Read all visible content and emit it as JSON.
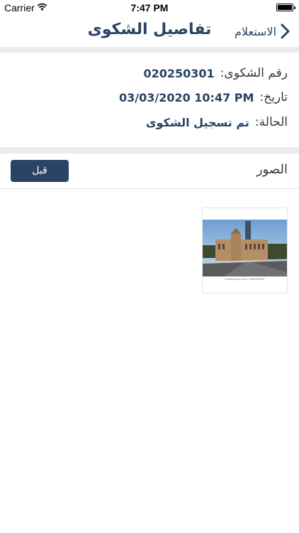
{
  "status_bar": {
    "carrier": "Carrier",
    "time": "7:47 PM"
  },
  "nav": {
    "title": "تفاصيل الشكوى",
    "back_label": "الاستعلام",
    "back_icon": "chevron-right-icon"
  },
  "details": {
    "number_label": "رقم الشكوى:",
    "number_value": "020250301",
    "date_label": "تاريخ:",
    "date_value": "03/03/2020 10:47 PM",
    "status_label": "الحالة:",
    "status_value": "تم تسجيل الشكوى"
  },
  "images_section": {
    "title": "الصور",
    "accept_label": "قبل",
    "thumbnail_caption": "shutterstock.com • 1466160087"
  },
  "colors": {
    "accent": "#2b4364",
    "separator": "#ececec"
  }
}
